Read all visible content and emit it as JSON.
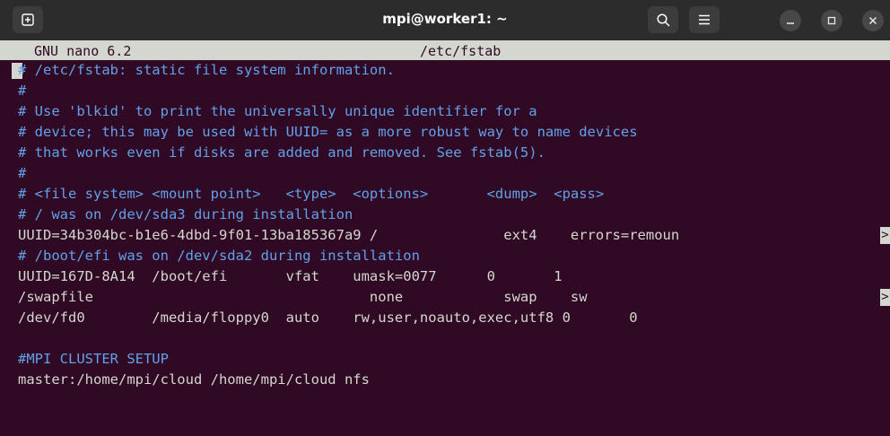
{
  "window": {
    "title": "mpi@worker1: ~",
    "buttons": {
      "new_tab_icon": "new-tab-icon",
      "search_icon": "search-icon",
      "menu_icon": "hamburger-menu-icon",
      "minimize_icon": "minimize-icon",
      "maximize_icon": "maximize-icon",
      "close_icon": "close-icon"
    }
  },
  "nano": {
    "version": "GNU nano 6.2",
    "filename": "/etc/fstab"
  },
  "colors": {
    "terminal_bg": "#300a24",
    "comment": "#62a0ea",
    "text": "#d3d7cf",
    "titlebar": "#2c2c2c"
  },
  "lines": [
    {
      "kind": "comment",
      "text": "# /etc/fstab: static file system information."
    },
    {
      "kind": "comment",
      "text": "#"
    },
    {
      "kind": "comment",
      "text": "# Use 'blkid' to print the universally unique identifier for a"
    },
    {
      "kind": "comment",
      "text": "# device; this may be used with UUID= as a more robust way to name devices"
    },
    {
      "kind": "comment",
      "text": "# that works even if disks are added and removed. See fstab(5)."
    },
    {
      "kind": "comment",
      "text": "#"
    },
    {
      "kind": "comment",
      "text": "# <file system> <mount point>   <type>  <options>       <dump>  <pass>"
    },
    {
      "kind": "comment",
      "text": "# / was on /dev/sda3 during installation"
    },
    {
      "kind": "plain",
      "text": "UUID=34b304bc-b1e6-4dbd-9f01-13ba185367a9 /               ext4    errors=remoun"
    },
    {
      "kind": "comment",
      "text": "# /boot/efi was on /dev/sda2 during installation"
    },
    {
      "kind": "plain",
      "text": "UUID=167D-8A14  /boot/efi       vfat    umask=0077      0       1"
    },
    {
      "kind": "plain",
      "text": "/swapfile                                 none            swap    sw"
    },
    {
      "kind": "plain",
      "text": "/dev/fd0        /media/floppy0  auto    rw,user,noauto,exec,utf8 0       0"
    },
    {
      "kind": "plain",
      "text": ""
    },
    {
      "kind": "comment",
      "text": "#MPI CLUSTER SETUP"
    },
    {
      "kind": "plain",
      "text": "master:/home/mpi/cloud /home/mpi/cloud nfs"
    }
  ],
  "overflow_marker": ">"
}
